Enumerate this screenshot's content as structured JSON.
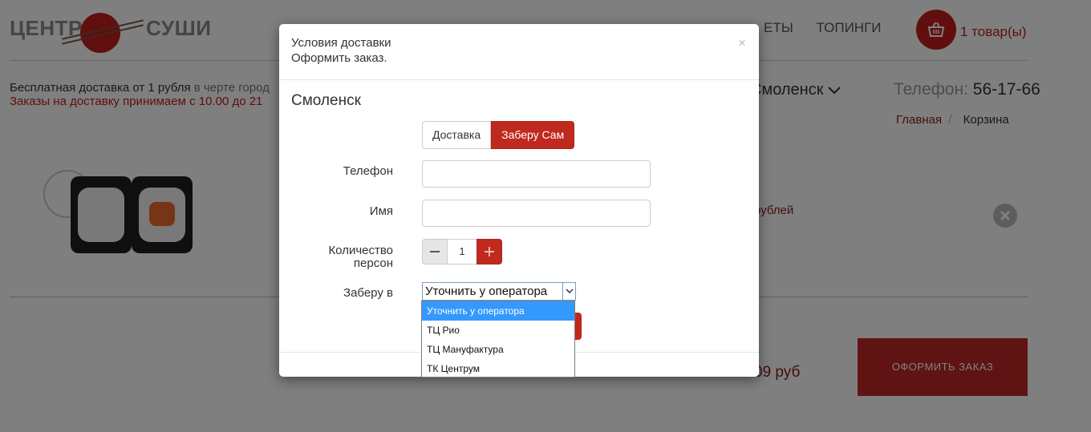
{
  "brand": {
    "word_left": "ЦЕНТР",
    "word_right": "СУШИ"
  },
  "nav": {
    "items": [
      "ЕТЫ",
      "ТОПИНГИ"
    ]
  },
  "cart": {
    "count": "1 товар(ы)"
  },
  "delivery": {
    "free_text": "Бесплатная доставка от 1 рубля",
    "free_suffix": "в черте город",
    "hours": "Заказы на доставку принимаем с 10.00 до 21"
  },
  "location": {
    "city": "Смоленск"
  },
  "contact": {
    "phone_label": "Телефон:",
    "phone_number": "56-17-66"
  },
  "breadcrumb": {
    "home": "Главная",
    "separator": "/",
    "current": "Корзина"
  },
  "cart_item": {
    "price_partial": "рублей"
  },
  "summary": {
    "total_partial": "09 руб",
    "order_button": "ОФОРМИТЬ ЗАКАЗ"
  },
  "modal": {
    "title": "Условия доставки",
    "subtitle": "Оформить заказ.",
    "close": "×",
    "city": "Смоленск",
    "mode": {
      "delivery": "Доставка",
      "pickup": "Заберу Сам",
      "selected": "pickup"
    },
    "fields": {
      "phone_label": "Телефон",
      "phone_value": "",
      "name_label": "Имя",
      "name_value": "",
      "persons_label_line1": "Количество",
      "persons_label_line2": "персон",
      "persons_value": "1",
      "pickup_label": "Заберу в"
    },
    "pickup_select": {
      "value": "Уточнить у оператора",
      "options": [
        "Уточнить у оператора",
        "ТЦ Рио",
        "ТЦ Мануфактура",
        "ТК Центрум"
      ],
      "highlighted_index": 0
    }
  },
  "colors": {
    "brand_red": "#c0291d",
    "dark_red": "#8b1a1a",
    "select_highlight": "#3399ff"
  }
}
